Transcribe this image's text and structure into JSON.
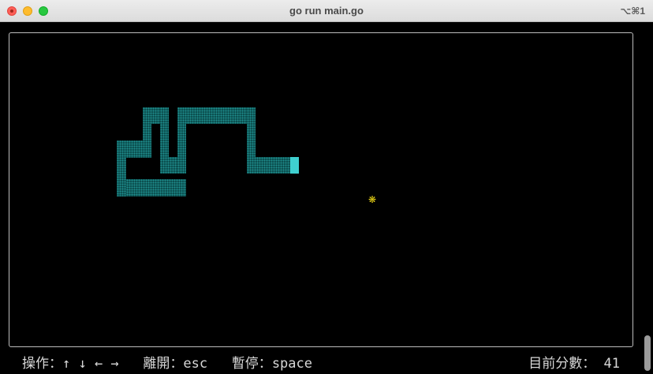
{
  "window": {
    "title": "go run main.go",
    "shortcut": "⌥⌘1"
  },
  "game": {
    "snake_color": "#0c4f4f",
    "snake_head_color": "#3fcfcf",
    "food_color": "#e9d315",
    "food_glyph": "❋"
  },
  "status": {
    "controls_label": "操作：",
    "controls_keys": "↑ ↓ ← →",
    "quit_label": "離開：",
    "quit_key": "esc",
    "pause_label": "暫停：",
    "pause_key": "space",
    "score_label": "目前分數：",
    "score_value": "41"
  }
}
